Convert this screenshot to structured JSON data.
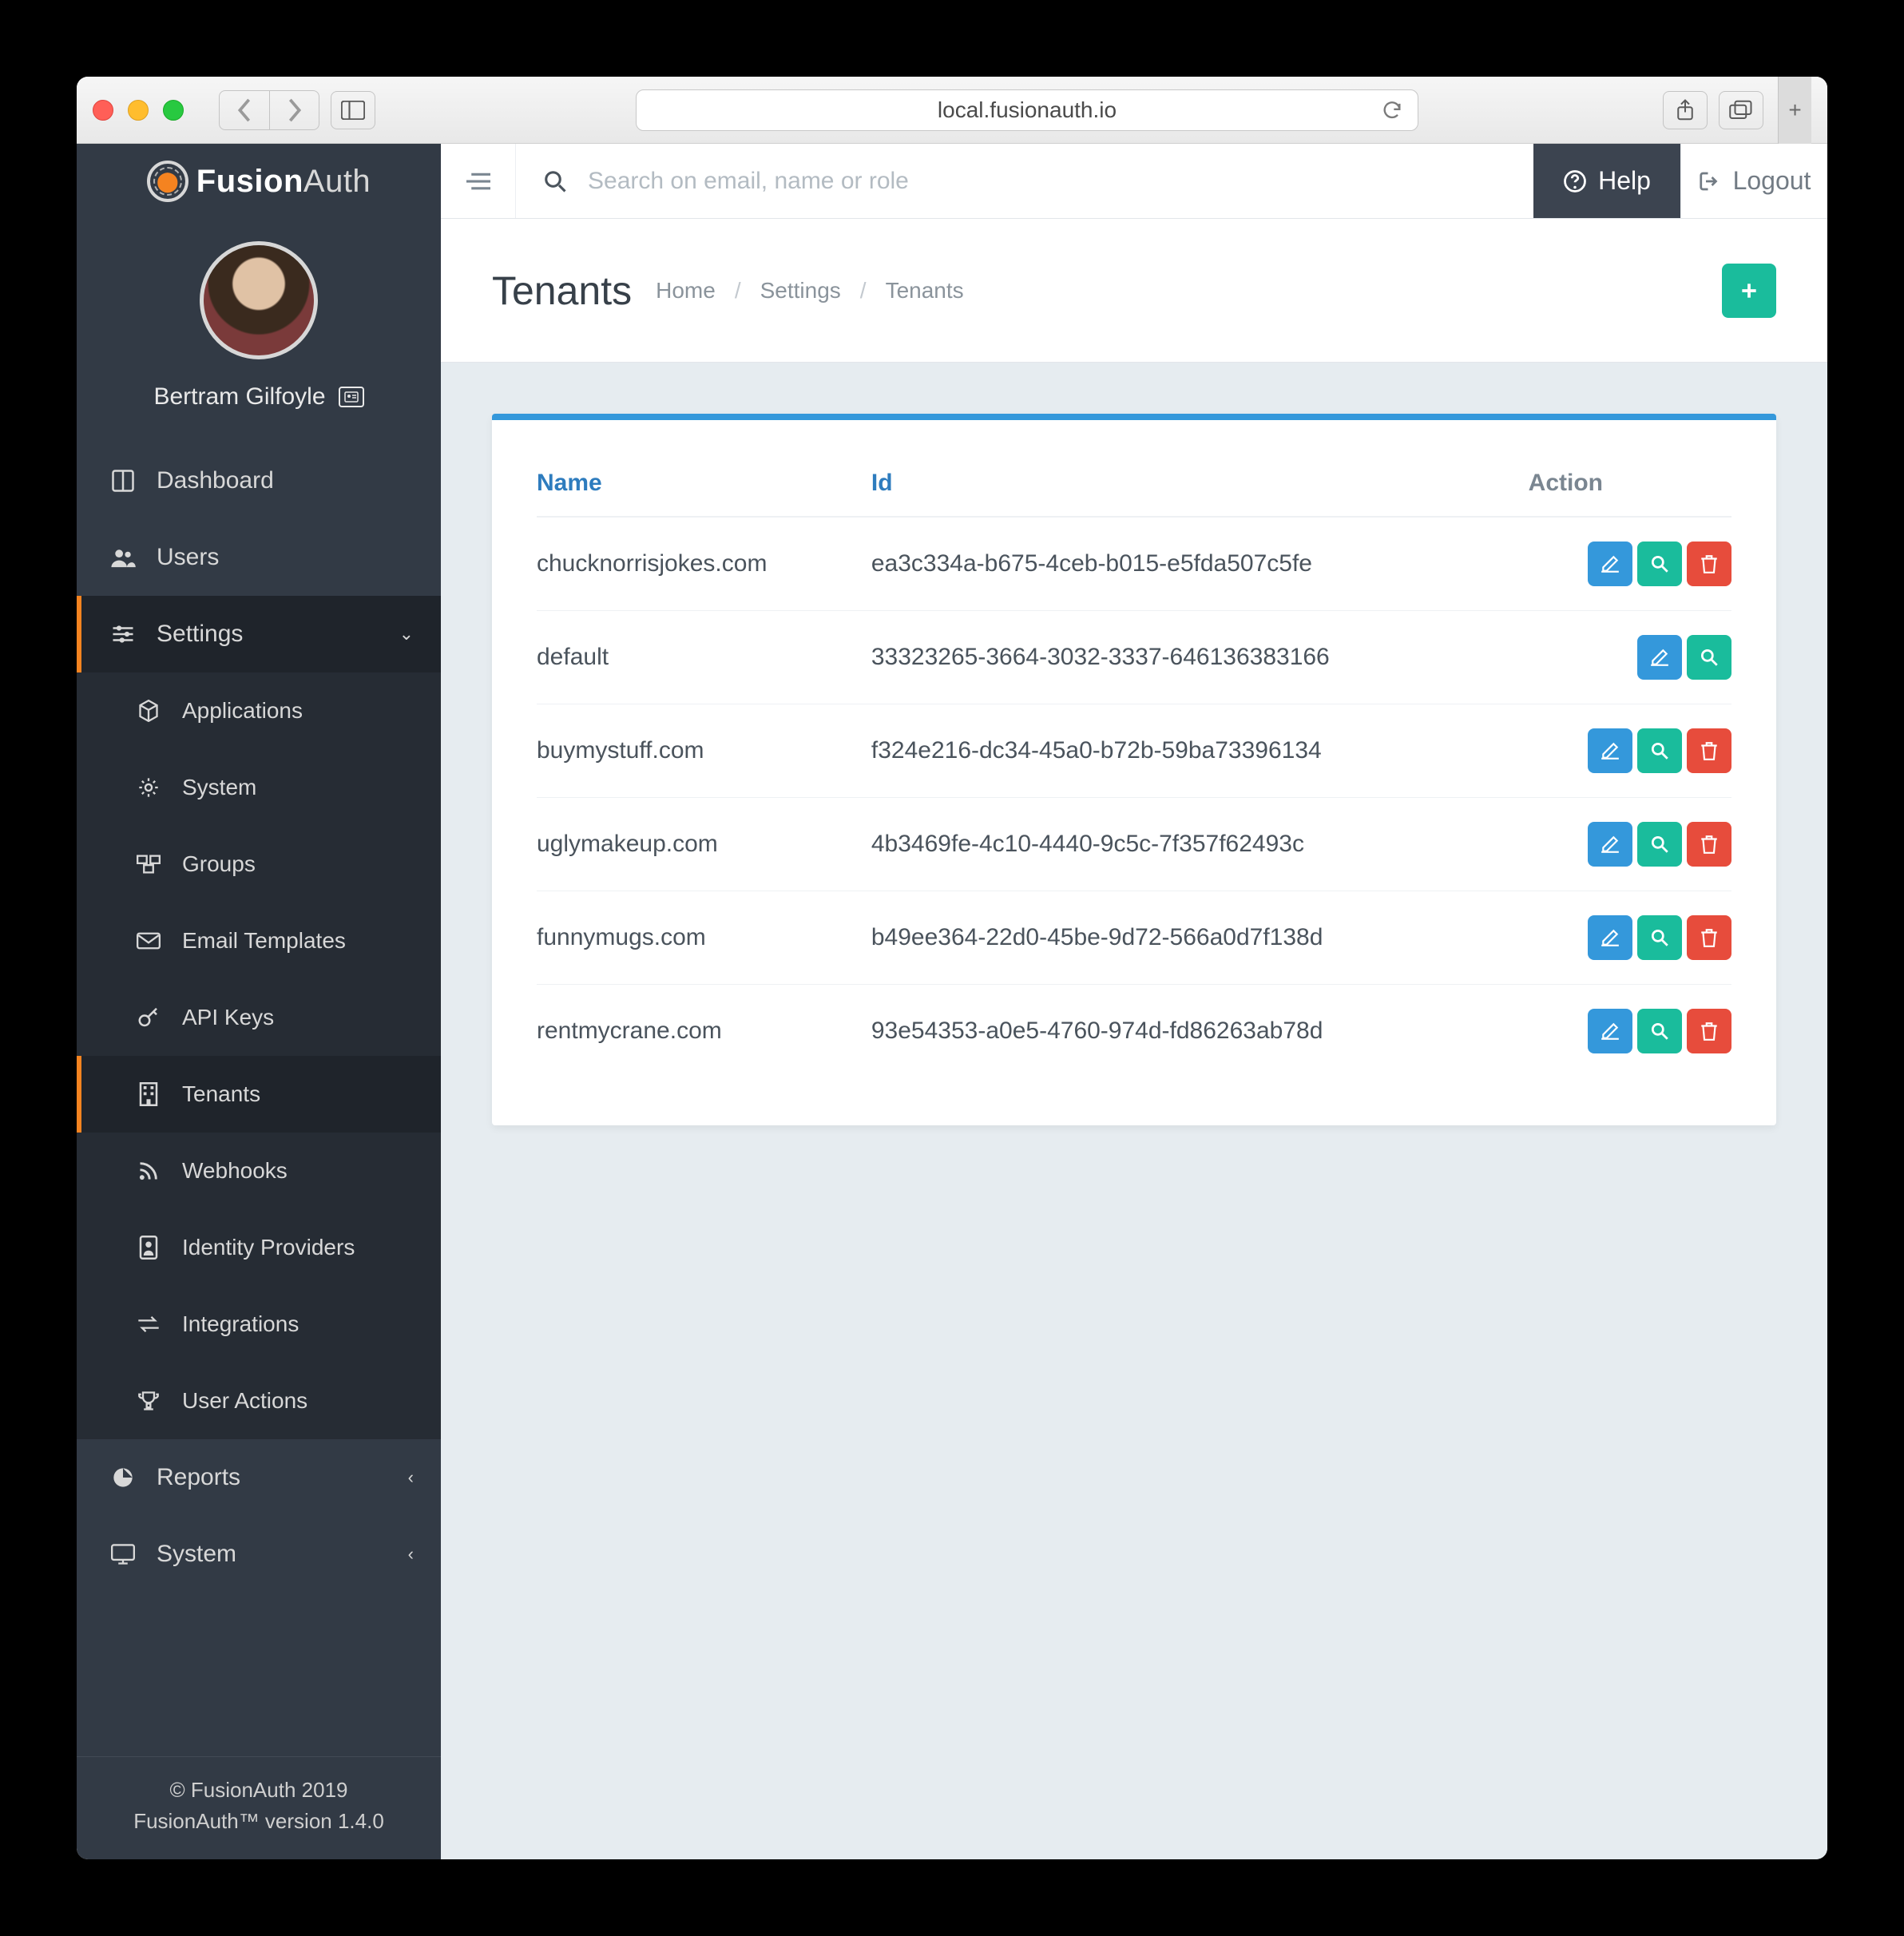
{
  "browser": {
    "url": "local.fusionauth.io"
  },
  "brand": {
    "name_prefix": "Fusion",
    "name_suffix": "Auth"
  },
  "user": {
    "display_name": "Bertram Gilfoyle"
  },
  "topbar": {
    "search_placeholder": "Search on email, name or role",
    "help_label": "Help",
    "logout_label": "Logout"
  },
  "page": {
    "title": "Tenants",
    "breadcrumbs": [
      "Home",
      "Settings",
      "Tenants"
    ]
  },
  "sidebar": {
    "dashboard": "Dashboard",
    "users": "Users",
    "settings": "Settings",
    "reports": "Reports",
    "system": "System",
    "settings_children": {
      "applications": "Applications",
      "systemSettings": "System",
      "groups": "Groups",
      "emailTemplates": "Email Templates",
      "apiKeys": "API Keys",
      "tenants": "Tenants",
      "webhooks": "Webhooks",
      "identityProviders": "Identity Providers",
      "integrations": "Integrations",
      "userActions": "User Actions"
    }
  },
  "table": {
    "headers": {
      "name": "Name",
      "id": "Id",
      "action": "Action"
    },
    "rows": [
      {
        "name": "chucknorrisjokes.com",
        "id": "ea3c334a-b675-4ceb-b015-e5fda507c5fe",
        "deletable": true
      },
      {
        "name": "default",
        "id": "33323265-3664-3032-3337-646136383166",
        "deletable": false
      },
      {
        "name": "buymystuff.com",
        "id": "f324e216-dc34-45a0-b72b-59ba73396134",
        "deletable": true
      },
      {
        "name": "uglymakeup.com",
        "id": "4b3469fe-4c10-4440-9c5c-7f357f62493c",
        "deletable": true
      },
      {
        "name": "funnymugs.com",
        "id": "b49ee364-22d0-45be-9d72-566a0d7f138d",
        "deletable": true
      },
      {
        "name": "rentmycrane.com",
        "id": "93e54353-a0e5-4760-974d-fd86263ab78d",
        "deletable": true
      }
    ]
  },
  "footer": {
    "copyright": "© FusionAuth 2019",
    "version": "FusionAuth™ version 1.4.0"
  }
}
